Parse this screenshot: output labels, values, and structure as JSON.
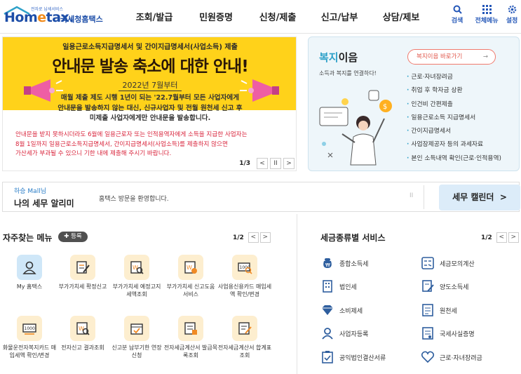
{
  "header": {
    "logo_tag": "전자로 납세서비스",
    "logo_text_a": "Hom",
    "logo_text_e": "e",
    "logo_text_b": "tax.",
    "logo_kor": "국세청홈택스",
    "nav": [
      "조회/발급",
      "민원증명",
      "신청/제출",
      "신고/납부",
      "상담/제보"
    ],
    "search_label": "검색",
    "menu_label": "전체메뉴",
    "settings_label": "설정"
  },
  "banner": {
    "subtitle": "일용근로소득지급명세서 및 간이지급명세서(사업소득) 제출",
    "title": "안내문 발송 축소에 대한 안내!",
    "date": "2022년 7월부터",
    "body": [
      "매월 제출 제도 시행 1년이 되는 '22.7월부터 모든 사업자에게",
      "안내문을 발송하지 않는 대신, 신규사업자 및 전월 원천세 신고 후",
      "미제출 사업자에게만 안내문을 발송합니다."
    ],
    "note": [
      "안내문을 받지 못하시더라도 6월에 일용근로자 또는 인적용역자에게 소득을 지급한 사업자는",
      "8월 1일까지 일용근로소득지급명세서, 간이지급명세서(사업소득)를 제출하지 않으면",
      "가산세가 부과될 수 있으니 기한 내에 제출해 주시기 바랍니다."
    ],
    "page": "1/3",
    "prev": "<",
    "pause": "II",
    "next": ">"
  },
  "welfare": {
    "title_a": "복지",
    "title_b": "이음",
    "subtitle": "소득과 복지를 연결하다!",
    "shortcut": "복지이음 바로가기",
    "items": [
      "근로·자녀장려금",
      "취업 후 학자금 상환",
      "인건비 간편제출",
      "일용근로소득 지급명세서",
      "간이지급명세서",
      "사업장제공자 등의 과세자료",
      "본인 소득내역 확인(근로·인적용역)"
    ]
  },
  "notice": {
    "tag": "하승 Mall님",
    "title": "나의 세무 알리미",
    "welcome": "홈택스 방문을 환영합니다.",
    "pause": "II",
    "calendar": "세무 캘린더",
    "calendar_arrow": ">"
  },
  "favorites": {
    "title": "자주찾는 메뉴",
    "register": "등록",
    "page": "1/2",
    "items": [
      "My 홈택스",
      "부가가치세 확정신고",
      "부가가치세 예정고지 세액조회",
      "부가가치세 신고도움 서비스",
      "사업용신용카드 매입세액 확인/변경",
      "화물운전자복지카드 매입세액 확인/변경",
      "전자신고 결과조회",
      "신고분 납부기한 연장 신청",
      "전자세금계산서 발급목록조회",
      "전자세금계산서 합계표조회"
    ]
  },
  "tax_services": {
    "title": "세금종류별 서비스",
    "page": "1/2",
    "items": [
      "종합소득세",
      "세금모의계산",
      "법인세",
      "양도소득세",
      "소비제세",
      "원천세",
      "사업자등록",
      "국세사실증명",
      "공익법인결산서류",
      "근로·자녀장려금"
    ]
  }
}
